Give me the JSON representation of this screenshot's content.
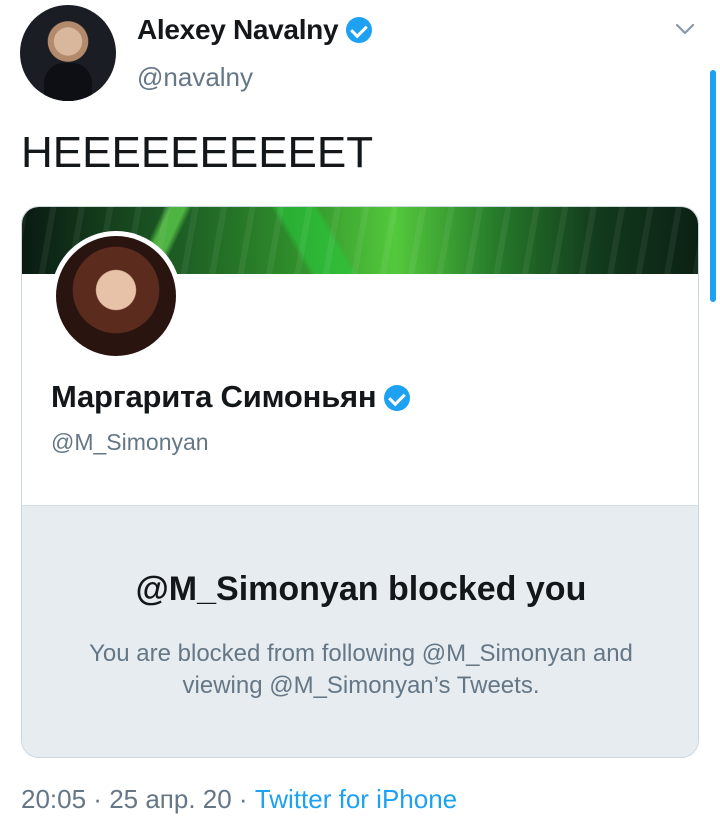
{
  "author": {
    "name": "Alexey Navalny",
    "handle": "@navalny"
  },
  "tweet": {
    "text": "НЕЕЕЕЕЕЕЕЕЕТ"
  },
  "card": {
    "name": "Маргарита Симоньян",
    "handle": "@M_Simonyan",
    "blocked_title": "@M_Simonyan blocked you",
    "blocked_description": "You are blocked from following @M_Simonyan and viewing @M_Simonyan’s Tweets."
  },
  "footer": {
    "time": "20:05",
    "separator": " · ",
    "date": "25 апр. 20",
    "source": "Twitter for iPhone"
  },
  "colors": {
    "accent": "#1da1f2",
    "muted_text": "#657786",
    "blocked_panel": "#e6ecf0"
  },
  "icons": [
    "verified-badge-icon",
    "chevron-down-icon"
  ]
}
